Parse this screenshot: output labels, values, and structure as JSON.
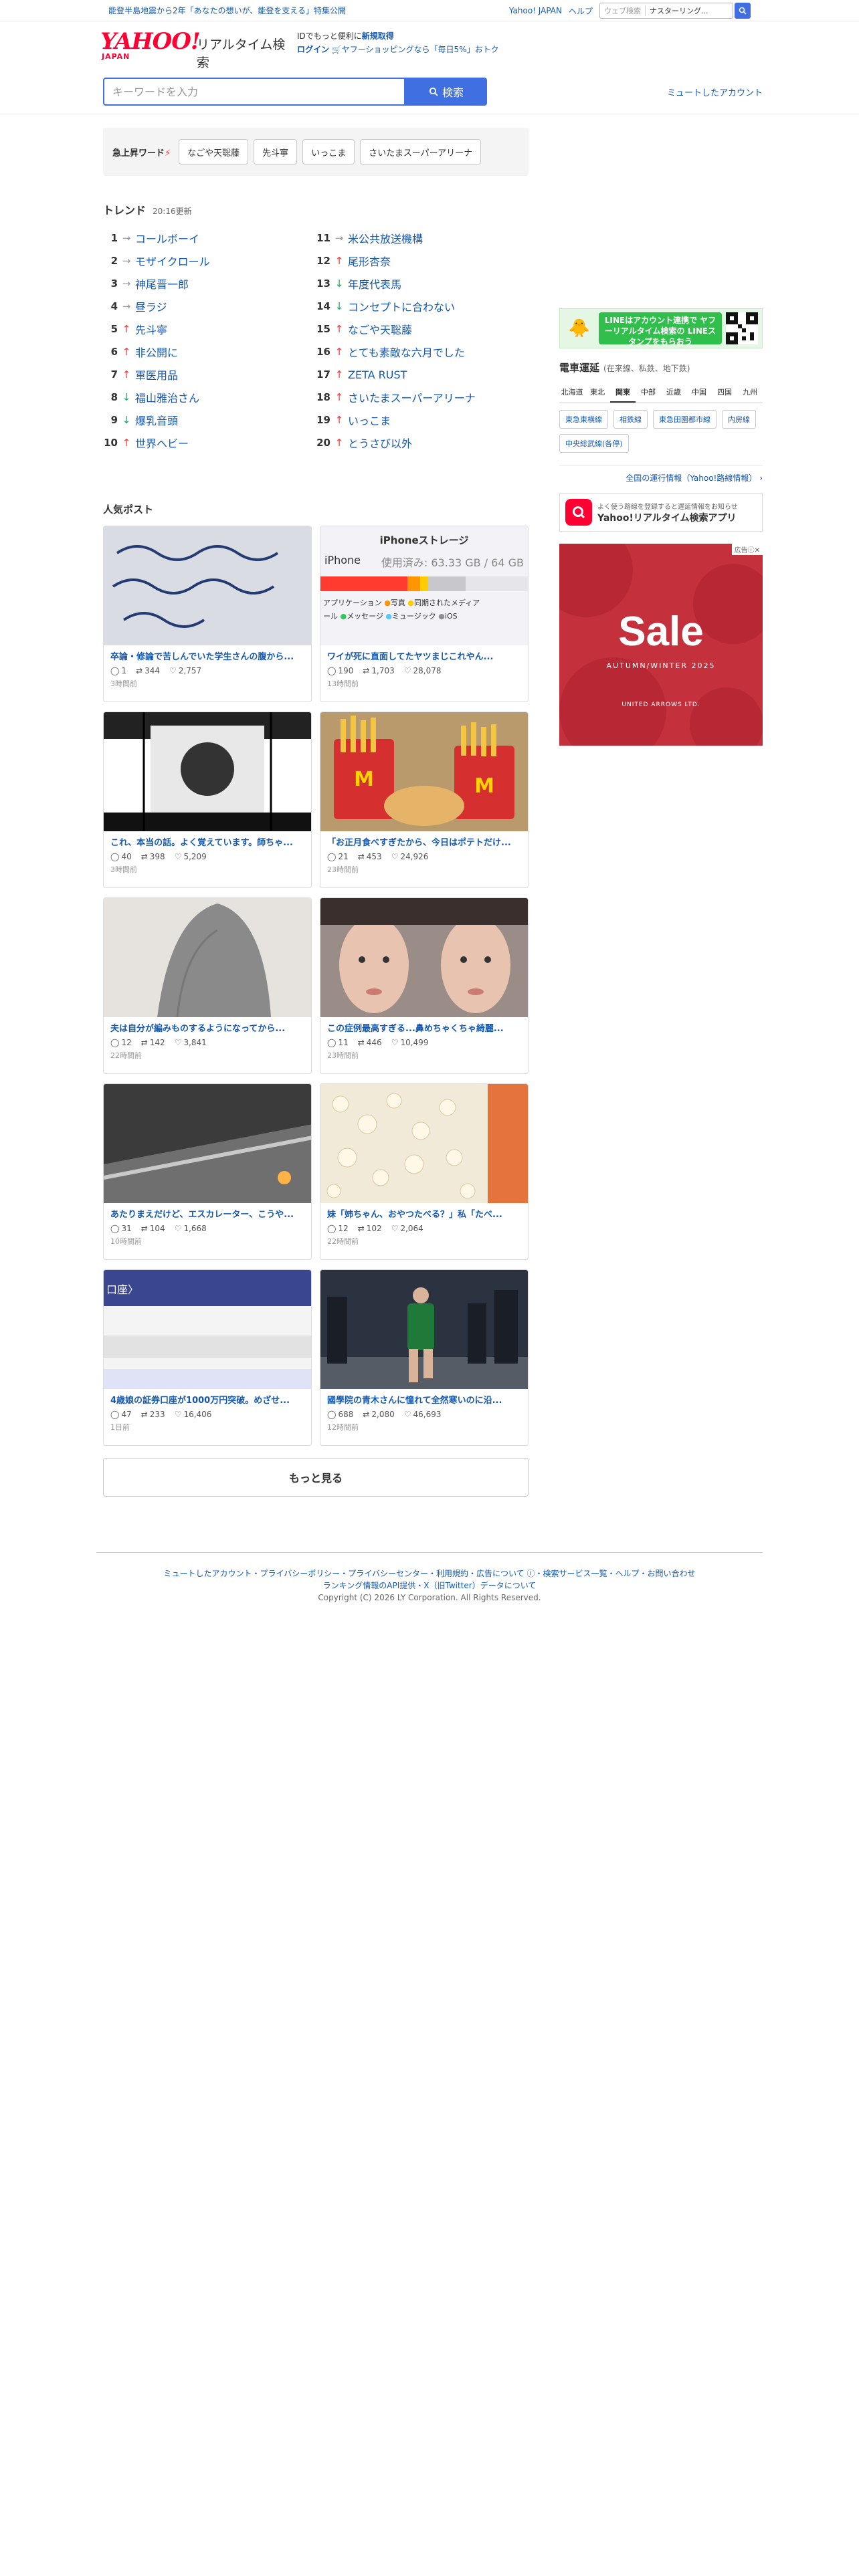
{
  "topbar": {
    "notice": "能登半島地震から2年「あなたの想いが、能登を支える」特集公開",
    "links": [
      "Yahoo! JAPAN",
      "ヘルプ"
    ],
    "web_search_placeholder": "ウェブ検索",
    "web_search_value": "ナスターリング..."
  },
  "header": {
    "logo_text": "YAHOO!",
    "logo_sub": "JAPAN",
    "service_name": "リアルタイム検索",
    "promo_line1_prefix": "IDでもっと便利に",
    "promo_line1_link": "新規取得",
    "promo_line2_link": "ログイン",
    "promo_line2_text": "ヤフーショッピングなら「毎日5%」おトク",
    "search_placeholder": "キーワードを入力",
    "search_button": "検索",
    "mute_link": "ミュートしたアカウント"
  },
  "hotwords": {
    "label": "急上昇ワード",
    "items": [
      "なごや天聡藤",
      "先斗寧",
      "いっこま",
      "さいたまスーパーアリーナ"
    ]
  },
  "trend": {
    "title": "トレンド",
    "updated": "20:16更新",
    "items": [
      {
        "rank": "1",
        "dir": "flat",
        "word": "コールボーイ"
      },
      {
        "rank": "2",
        "dir": "flat",
        "word": "モザイクロール"
      },
      {
        "rank": "3",
        "dir": "flat",
        "word": "神尾晋一郎"
      },
      {
        "rank": "4",
        "dir": "flat",
        "word": "昼ラジ"
      },
      {
        "rank": "5",
        "dir": "up",
        "word": "先斗寧"
      },
      {
        "rank": "6",
        "dir": "up",
        "word": "非公開に"
      },
      {
        "rank": "7",
        "dir": "up",
        "word": "軍医用品"
      },
      {
        "rank": "8",
        "dir": "down",
        "word": "福山雅治さん"
      },
      {
        "rank": "9",
        "dir": "down",
        "word": "爆乳音頭"
      },
      {
        "rank": "10",
        "dir": "up",
        "word": "世界ヘビー"
      },
      {
        "rank": "11",
        "dir": "flat",
        "word": "米公共放送機構"
      },
      {
        "rank": "12",
        "dir": "up",
        "word": "尾形杏奈"
      },
      {
        "rank": "13",
        "dir": "down",
        "word": "年度代表馬"
      },
      {
        "rank": "14",
        "dir": "down",
        "word": "コンセプトに合わない"
      },
      {
        "rank": "15",
        "dir": "up",
        "word": "なごや天聡藤"
      },
      {
        "rank": "16",
        "dir": "up",
        "word": "とても素敵な六月でした"
      },
      {
        "rank": "17",
        "dir": "up",
        "word": "ZETA RUST"
      },
      {
        "rank": "18",
        "dir": "up",
        "word": "さいたまスーパーアリーナ"
      },
      {
        "rank": "19",
        "dir": "up",
        "word": "いっこま"
      },
      {
        "rank": "20",
        "dir": "up",
        "word": "とうさび以外"
      }
    ]
  },
  "posts": {
    "title": "人気ポスト",
    "more": "もっと見る",
    "items": [
      {
        "text": "卒論・修論で苦しんでいた学生さんの腹から...",
        "replies": "1",
        "reposts": "344",
        "likes": "2,757",
        "time": "3時間前",
        "img": "handwriting"
      },
      {
        "text": "ワイが死に直面してたヤツまじこれやん...",
        "replies": "190",
        "reposts": "1,703",
        "likes": "28,078",
        "time": "13時間前",
        "img": "storage",
        "img_title": "iPhoneストレージ",
        "img_usage": "使用済み: 63.33 GB / 64 GB",
        "img_label1": "iPhone",
        "img_legend": [
          "アプリケーション",
          "写真",
          "同期されたメディア",
          "ール",
          "メッセージ",
          "ミュージック",
          "iOS"
        ]
      },
      {
        "text": "これ、本当の話。よく覚えています。師ちゃ...",
        "replies": "40",
        "reposts": "398",
        "likes": "5,209",
        "time": "3時間前",
        "img": "manga"
      },
      {
        "text": "「お正月食べすぎたから、今日はポテトだけ...",
        "replies": "21",
        "reposts": "453",
        "likes": "24,926",
        "time": "23時間前",
        "img": "fries"
      },
      {
        "text": "夫は自分が編みものするようになってから...",
        "replies": "12",
        "reposts": "142",
        "likes": "3,841",
        "time": "22時間前",
        "img": "knit"
      },
      {
        "text": "この症例最高すぎる...鼻めちゃくちゃ綺麗...",
        "replies": "11",
        "reposts": "446",
        "likes": "10,499",
        "time": "23時間前",
        "img": "faces"
      },
      {
        "text": "あたりまえだけど、エスカレーター、こうや...",
        "replies": "31",
        "reposts": "104",
        "likes": "1,668",
        "time": "10時間前",
        "img": "escalator"
      },
      {
        "text": "妹「姉ちゃん、おやつたべる？」私「たべ...",
        "replies": "12",
        "reposts": "102",
        "likes": "2,064",
        "time": "22時間前",
        "img": "popcorn"
      },
      {
        "text": "4歳娘の証券口座が1000万円突破。めざせ...",
        "replies": "47",
        "reposts": "233",
        "likes": "16,406",
        "time": "1日前",
        "img": "account",
        "img_label": "口座〉"
      },
      {
        "text": "國學院の青木さんに憧れて全然寒いのに沿...",
        "replies": "688",
        "reposts": "2,080",
        "likes": "46,693",
        "time": "12時間前",
        "img": "runner"
      }
    ]
  },
  "sidebar": {
    "line_banner_text": "LINEはアカウント連携で ヤフーリアルタイム検索の LINEスタンプをもらおう",
    "train_title": "電車運延",
    "train_sub": "(在来線、私鉄、地下鉄)",
    "regions": [
      "北海道",
      "東北",
      "関東",
      "中部",
      "近畿",
      "中国",
      "四国",
      "九州"
    ],
    "active_region": "関東",
    "lines": [
      "東急東横線",
      "相鉄線",
      "東急田園都市線",
      "内房線",
      "中央総武線(各停)"
    ],
    "all_lines_link": "全国の運行情報（Yahoo!路線情報）",
    "app_small": "よく使う路線を登録すると遅延情報をお知らせ",
    "app_big": "Yahoo!リアルタイム検索アプリ",
    "ad_mark": "広告ⓘ✕",
    "ad_sale": "Sale",
    "ad_season": "AUTUMN/WINTER 2025",
    "ad_brand": "UNITED ARROWS LTD."
  },
  "footer": {
    "links_line1": "ミュートしたアカウント・プライバシーポリシー・プライバシーセンター・利用規約・広告について ⓘ・検索サービス一覧・ヘルプ・お問い合わせ",
    "links_line2": "ランキング情報のAPI提供・X（旧Twitter）データについて",
    "copyright": "Copyright (C) 2026 LY Corporation. All Rights Reserved."
  },
  "colors": {
    "accent": "#3f6fe0",
    "link": "#1558b0",
    "brand": "#ff0033",
    "up": "#ff3333",
    "down": "#14aa5a",
    "flat": "#999999"
  }
}
